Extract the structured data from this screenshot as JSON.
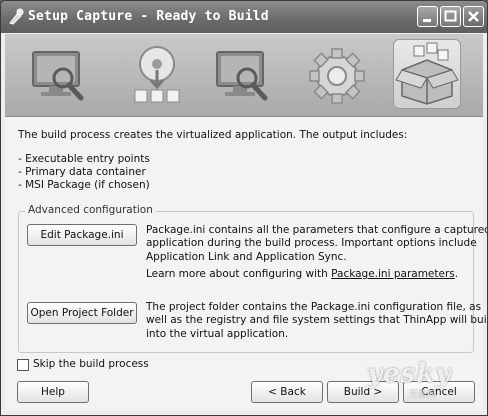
{
  "window": {
    "title": "Setup Capture - Ready to Build"
  },
  "wizard_steps": [
    {
      "icon": "monitor-magnifier-icon"
    },
    {
      "icon": "disc-install-icon"
    },
    {
      "icon": "monitor-magnifier-icon"
    },
    {
      "icon": "gear-icon"
    },
    {
      "icon": "package-box-icon",
      "current": true
    }
  ],
  "intro": "The build process creates the virtualized application. The output includes:",
  "outputs": [
    "- Executable entry points",
    "- Primary data container",
    "- MSI Package (if chosen)"
  ],
  "advanced": {
    "label": "Advanced configuration",
    "edit_button": "Edit Package.ini",
    "edit_desc": [
      "Package.ini contains all the parameters that configure a captured",
      "application during the build process. Important options include",
      "Application Link and Application Sync."
    ],
    "learn_more_prefix": "Learn more about configuring with ",
    "learn_more_link": "Package.ini parameters",
    "learn_more_suffix": ".",
    "open_button": "Open Project Folder",
    "open_desc": [
      "The project folder contains the Package.ini configuration file, as",
      "well as the registry and file system settings that ThinApp will build",
      "into the virtual application."
    ]
  },
  "skip_build": {
    "label": "Skip the build process",
    "checked": false
  },
  "footer": {
    "help": "Help",
    "back": "< Back",
    "build": "Build >",
    "cancel": "Cancel"
  },
  "watermark": {
    "text": "yesky",
    "sub": "天极网"
  }
}
